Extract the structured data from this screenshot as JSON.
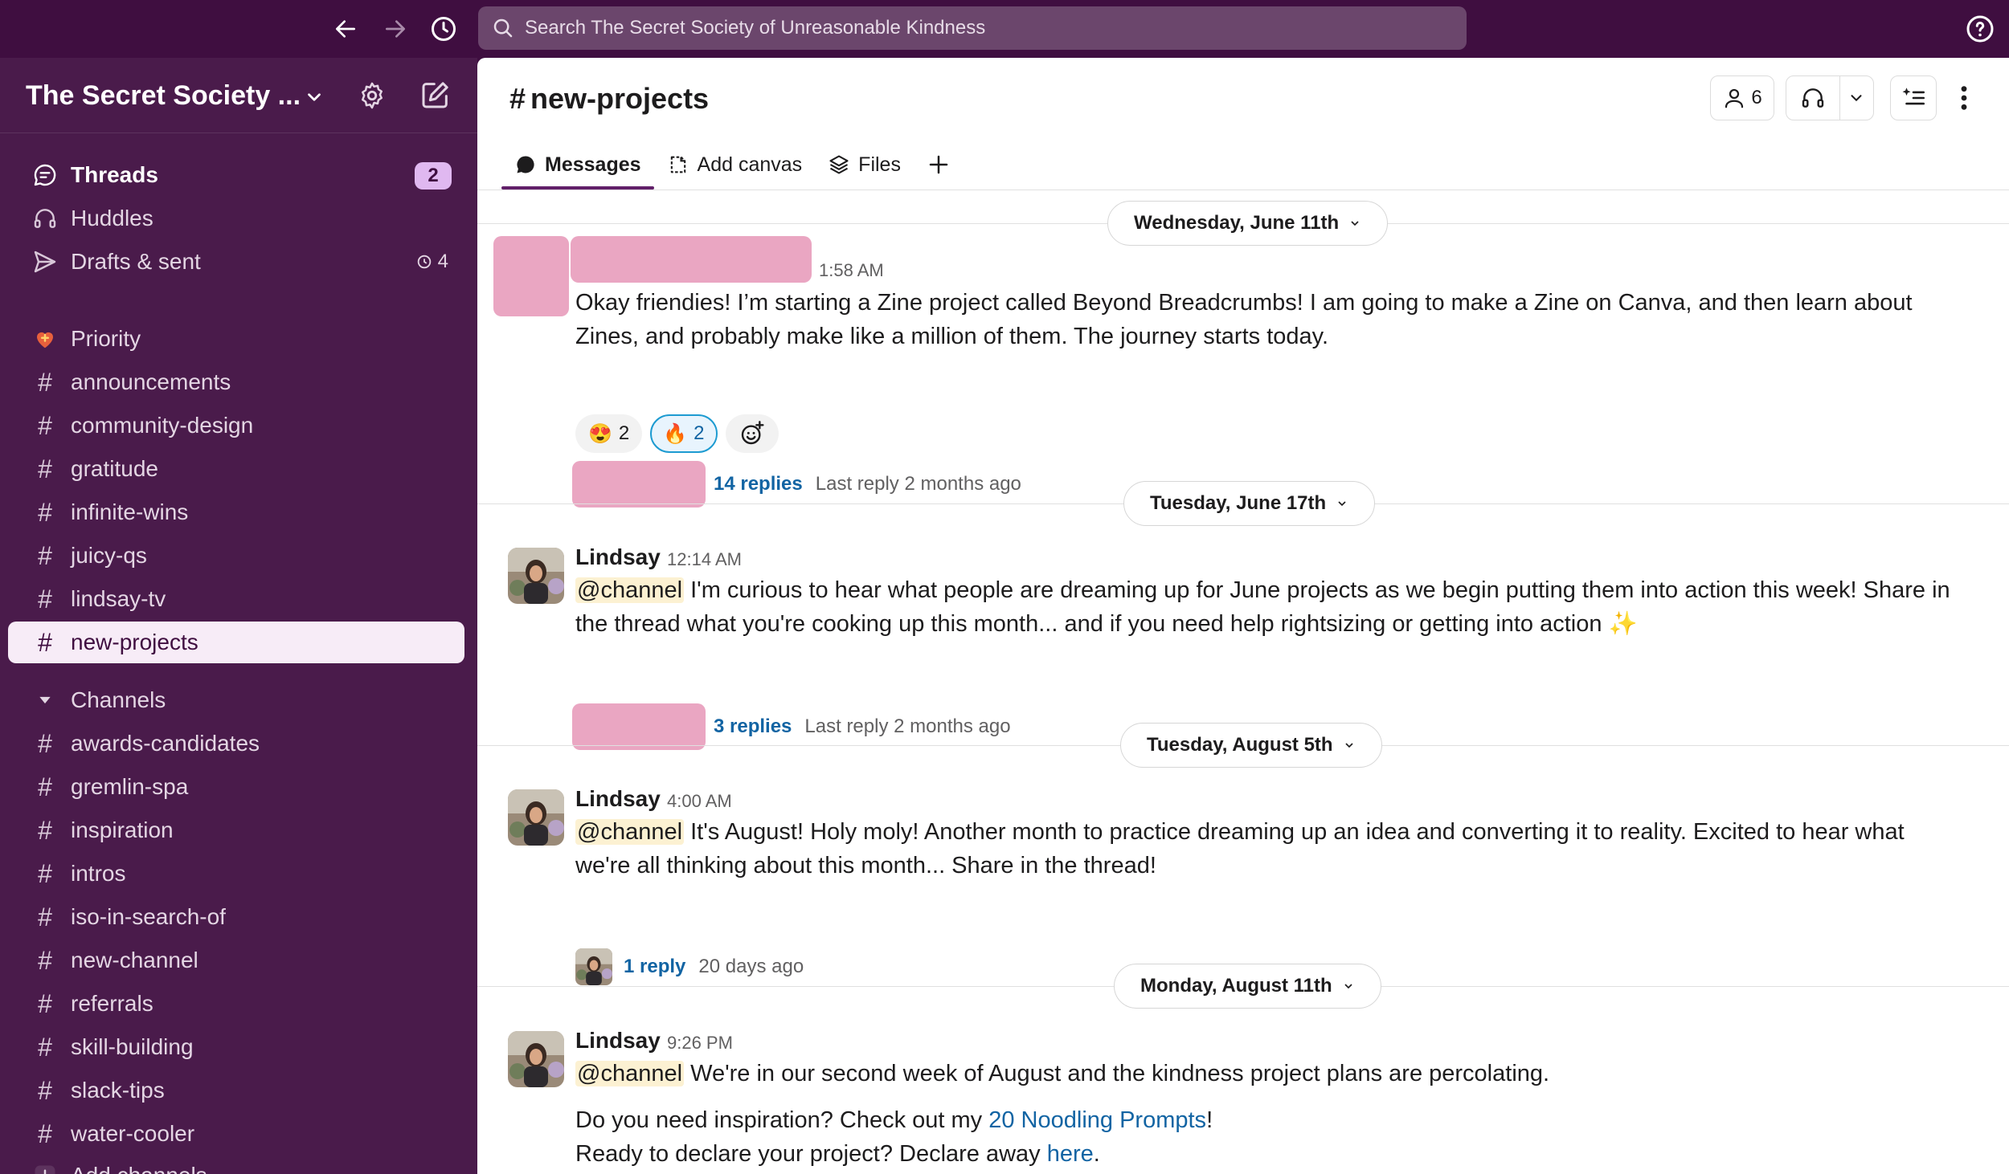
{
  "topbar": {
    "search_placeholder": "Search The Secret Society of Unreasonable Kindness"
  },
  "workspace": {
    "name": "The Secret Society ..."
  },
  "sidebar": {
    "threads": {
      "label": "Threads",
      "badge": "2"
    },
    "huddles": {
      "label": "Huddles"
    },
    "drafts": {
      "label": "Drafts & sent",
      "count": "4"
    },
    "priority": {
      "label": "Priority"
    },
    "priority_channels": [
      "announcements",
      "community-design",
      "gratitude",
      "infinite-wins",
      "juicy-qs",
      "lindsay-tv",
      "new-projects"
    ],
    "channels_section": {
      "label": "Channels"
    },
    "channels": [
      "awards-candidates",
      "gremlin-spa",
      "inspiration",
      "intros",
      "iso-in-search-of",
      "new-channel",
      "referrals",
      "skill-building",
      "slack-tips",
      "water-cooler"
    ],
    "add_channels": "Add channels"
  },
  "channel": {
    "title": "new-projects",
    "member_count": "6",
    "tabs": [
      {
        "label": "Messages"
      },
      {
        "label": "Add canvas"
      },
      {
        "label": "Files"
      }
    ]
  },
  "days": [
    "Wednesday, June 11th",
    "Tuesday, June 17th",
    "Tuesday, August 5th",
    "Monday, August 11th"
  ],
  "messages": [
    {
      "time": "1:58 AM",
      "text": "Okay friendies! I’m starting a Zine project called Beyond Breadcrumbs! I am going to make a Zine on Canva, and then learn about Zines, and probably make like a million of them. The journey starts today.",
      "reactions": [
        {
          "emoji": "😍",
          "count": "2"
        },
        {
          "emoji": "🔥",
          "count": "2"
        }
      ],
      "replies": "14 replies",
      "last_reply": "Last reply 2 months ago"
    },
    {
      "author": "Lindsay",
      "time": "12:14 AM",
      "mention": "@channel",
      "text": "I'm curious to hear what people are dreaming up for June projects as we begin putting them into action this week! Share in the thread what you're cooking up this month... and if you need help rightsizing or getting into action ✨",
      "replies": "3 replies",
      "last_reply": "Last reply 2 months ago"
    },
    {
      "author": "Lindsay",
      "time": "4:00 AM",
      "mention": "@channel",
      "text": "It's August! Holy moly! Another month to practice dreaming up an idea and converting it to reality. Excited to hear what we're all thinking about this month... Share in the thread!",
      "replies": "1 reply",
      "last_reply": "20 days ago"
    },
    {
      "author": "Lindsay",
      "time": "9:26 PM",
      "mention": "@channel",
      "text": "We're in our second week of August and the kindness project plans are percolating.",
      "line2_prefix": "Do you need inspiration? Check out my ",
      "line2_link": "20 Noodling Prompts",
      "line2_suffix": "!",
      "line3_prefix": "Ready to declare your project? Declare away ",
      "line3_link": "here",
      "line3_suffix": "."
    }
  ],
  "colors": {
    "aubergine": "#3f0e40",
    "sidebar": "#4a1b4b",
    "link": "#1264a3",
    "redaction": "#eaa6c2"
  }
}
